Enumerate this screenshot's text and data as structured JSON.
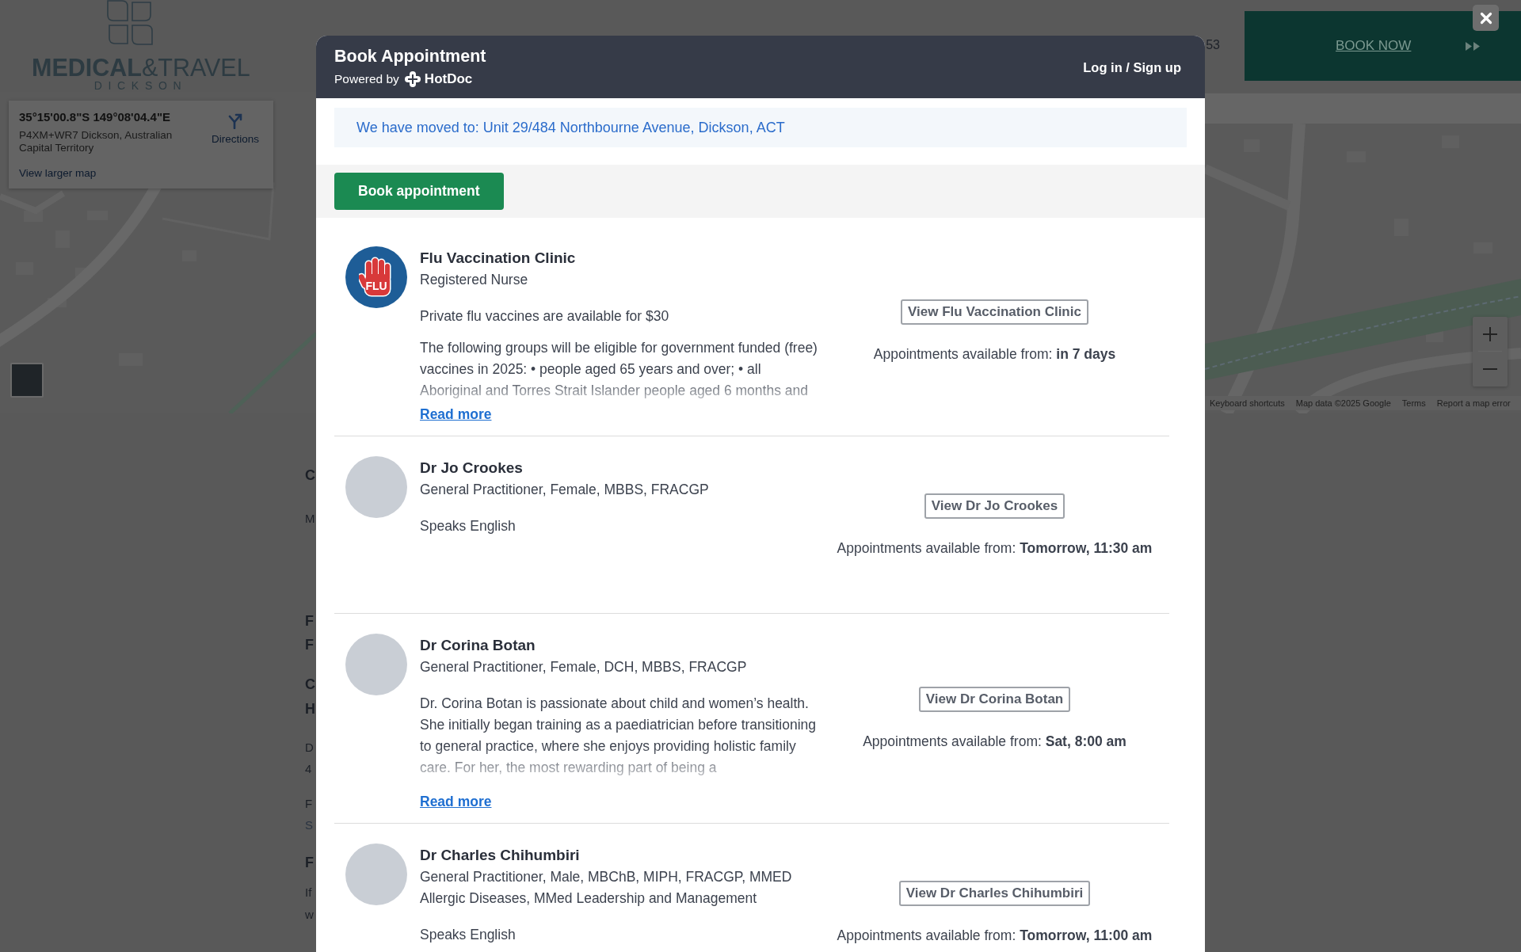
{
  "page": {
    "logo": {
      "wordmark": "**MEDICAL**&TRAVEL",
      "tagline": "DICKSON"
    },
    "partial_text": "53",
    "banner": {
      "link": "BOOK NOW"
    }
  },
  "map": {
    "info_card": {
      "coordinates": "35°15'00.8\"S 149°08'04.4\"E",
      "address": "P4XM+WR7 Dickson, Australian Capital Territory",
      "directions": "Directions",
      "link": "View larger map"
    },
    "attribution": [
      "Keyboard shortcuts",
      "Map data ©2025 Google",
      "Terms",
      "Report a map error"
    ]
  },
  "page_fragments": [
    {
      "kind": "heading",
      "text": "C"
    },
    {
      "kind": "text",
      "text": "M"
    },
    {
      "kind": "heading",
      "text": "F"
    },
    {
      "kind": "heading",
      "text": "F"
    },
    {
      "kind": "heading",
      "text": "C"
    },
    {
      "kind": "heading",
      "text": "H"
    },
    {
      "kind": "text",
      "text": "D"
    },
    {
      "kind": "text",
      "text": "4"
    },
    {
      "kind": "text",
      "text": "F"
    },
    {
      "kind": "muted",
      "text": "S"
    },
    {
      "kind": "heading",
      "text": "F"
    },
    {
      "kind": "text",
      "text": "If"
    },
    {
      "kind": "text",
      "text": "w"
    }
  ],
  "modal": {
    "title": "Book Appointment",
    "powered_by": "Powered by",
    "brand": "HotDoc",
    "login": "Log in / Sign up",
    "notice": "We have moved to: Unit 29/484 Northbourne Avenue, Dickson, ACT",
    "book_button": "Book appointment",
    "practitioners": [
      {
        "kind": "logo",
        "logo_text": "FLU",
        "name": "Flu Vaccination Clinic",
        "subtitle": "Registered Nurse",
        "note": "Private flu vaccines are available for $30",
        "description": "The following groups will be eligible for government funded (free) vaccines in 2025: • people aged 65 years and over; • all Aboriginal and Torres Strait Islander people aged 6 months and",
        "read_more": "Read more",
        "view_button": "View Flu Vaccination Clinic",
        "availability": "Appointments available from: **in 7 days**"
      },
      {
        "kind": "photo",
        "name": "Dr Jo Crookes",
        "subtitle": "General Practitioner, Female, MBBS, FRACGP",
        "note": "Speaks English",
        "view_button": "View Dr Jo Crookes",
        "availability": "Appointments available from: **Tomorrow, 11:30 am**"
      },
      {
        "kind": "photo",
        "name": "Dr Corina Botan",
        "subtitle": "General Practitioner, Female, DCH, MBBS, FRACGP",
        "description": "Dr. Corina Botan is passionate about child and women’s health. She initially began training as a paediatrician before transitioning to general practice, where she enjoys providing holistic family care. For her, the most rewarding part of being a",
        "read_more": "Read more",
        "view_button": "View Dr Corina Botan",
        "availability": "Appointments available from: **Sat, 8:00 am**"
      },
      {
        "kind": "photo",
        "name": "Dr Charles Chihumbiri",
        "subtitle": "General Practitioner, Male, MBChB, MIPH, FRACGP, MMED Allergic Diseases, MMed Leadership and Management",
        "note": "Speaks English",
        "view_button": "View Dr Charles Chihumbiri",
        "availability": "Appointments available from: **Tomorrow, 11:00 am**"
      }
    ]
  }
}
